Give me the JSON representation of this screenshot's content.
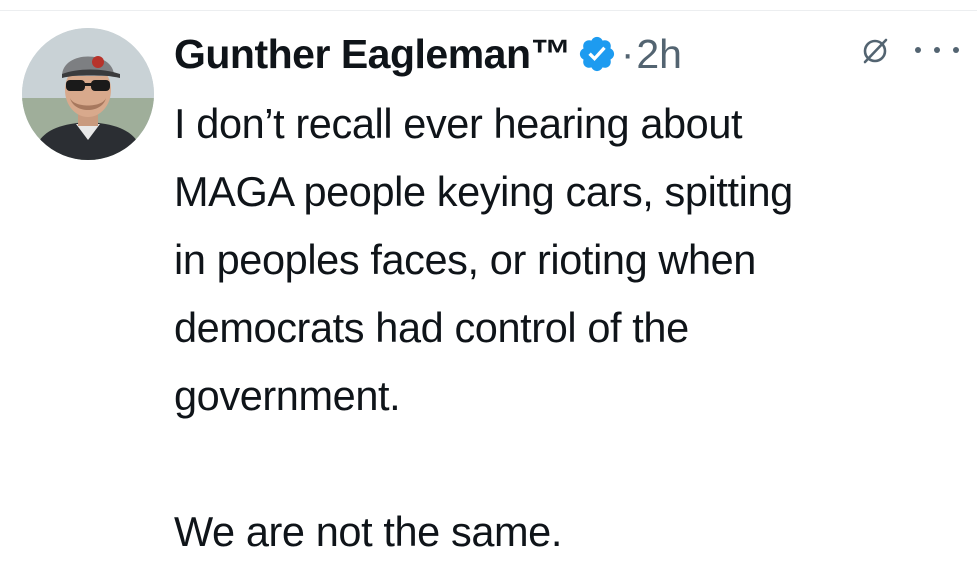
{
  "tweet": {
    "author": {
      "display_name": "Gunther Eagleman™",
      "verified": true,
      "avatar_icon": "profile-photo"
    },
    "separator": "·",
    "timestamp": "2h",
    "header_icons": [
      "grok-icon",
      "more-icon"
    ],
    "body": {
      "paragraph_1": "I don’t recall ever hearing about\nMAGA people keying cars, spitting\nin peoples faces, or rioting when\ndemocrats had control of the\ngovernment.",
      "paragraph_2": "We are not the same."
    }
  },
  "colors": {
    "text": "#0f1419",
    "secondary_text": "#536471",
    "verified_badge": "#1d9bf0",
    "background": "#ffffff"
  }
}
